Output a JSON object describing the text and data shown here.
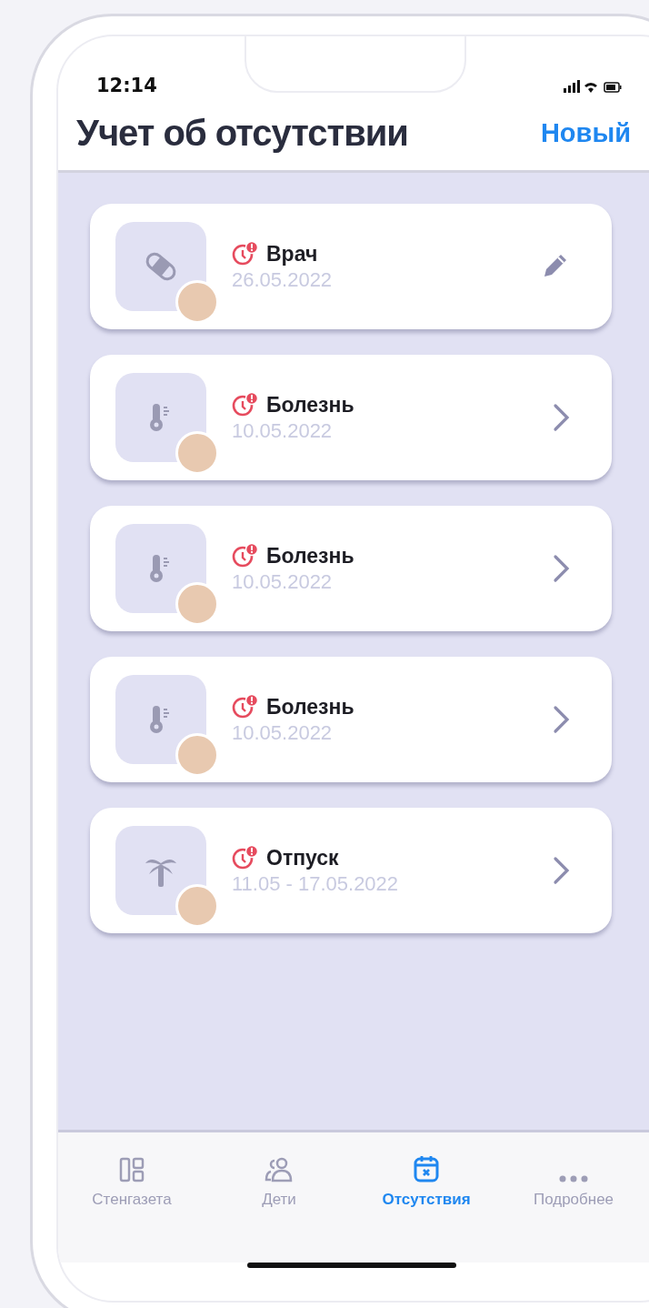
{
  "status_bar": {
    "time": "12:14"
  },
  "header": {
    "title": "Учет об отсутствии",
    "action": "Новый"
  },
  "absences": [
    {
      "kind": "bandage",
      "title": "Врач",
      "date": "26.05.2022",
      "editable": true
    },
    {
      "kind": "thermometer",
      "title": "Болезнь",
      "date": "10.05.2022",
      "editable": false
    },
    {
      "kind": "thermometer",
      "title": "Болезнь",
      "date": "10.05.2022",
      "editable": false
    },
    {
      "kind": "thermometer",
      "title": "Болезнь",
      "date": "10.05.2022",
      "editable": false
    },
    {
      "kind": "palm",
      "title": "Отпуск",
      "date": "11.05 - 17.05.2022",
      "editable": false
    }
  ],
  "tabs": [
    {
      "label": "Стенгазета",
      "selected": false
    },
    {
      "label": "Дети",
      "selected": false
    },
    {
      "label": "Отсутствия",
      "selected": true
    },
    {
      "label": "Подробнее",
      "selected": false
    }
  ]
}
